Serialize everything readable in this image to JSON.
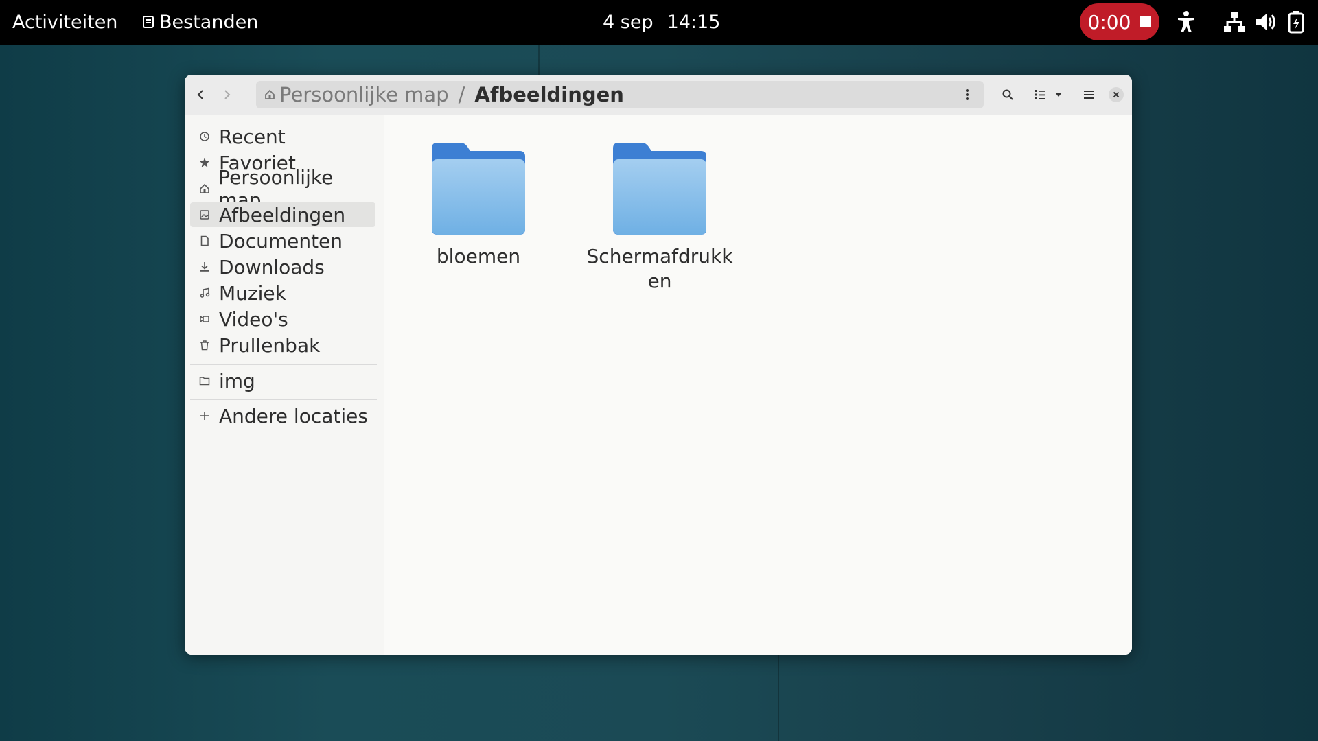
{
  "topbar": {
    "activities": "Activiteiten",
    "app_name": "Bestanden",
    "date": "4 sep",
    "time": "14:15",
    "recording_time": "0:00",
    "recording_color": "#c01c28"
  },
  "window": {
    "path": {
      "home": "Persoonlijke map",
      "separator": "/",
      "current": "Afbeeldingen"
    },
    "sidebar": {
      "items": [
        {
          "label": "Recent",
          "icon": "clock-icon"
        },
        {
          "label": "Favoriet",
          "icon": "star-icon"
        },
        {
          "label": "Persoonlijke map",
          "icon": "home-icon"
        },
        {
          "label": "Afbeeldingen",
          "icon": "image-icon",
          "active": true
        },
        {
          "label": "Documenten",
          "icon": "document-icon"
        },
        {
          "label": "Downloads",
          "icon": "download-icon"
        },
        {
          "label": "Muziek",
          "icon": "music-icon"
        },
        {
          "label": "Video's",
          "icon": "video-icon"
        },
        {
          "label": "Prullenbak",
          "icon": "trash-icon"
        }
      ],
      "bookmarks": [
        {
          "label": "img",
          "icon": "folder-icon"
        }
      ],
      "other": {
        "label": "Andere locaties",
        "icon": "plus-icon"
      }
    },
    "folders": [
      {
        "name": "bloemen"
      },
      {
        "name": "Schermafdrukken"
      }
    ]
  }
}
